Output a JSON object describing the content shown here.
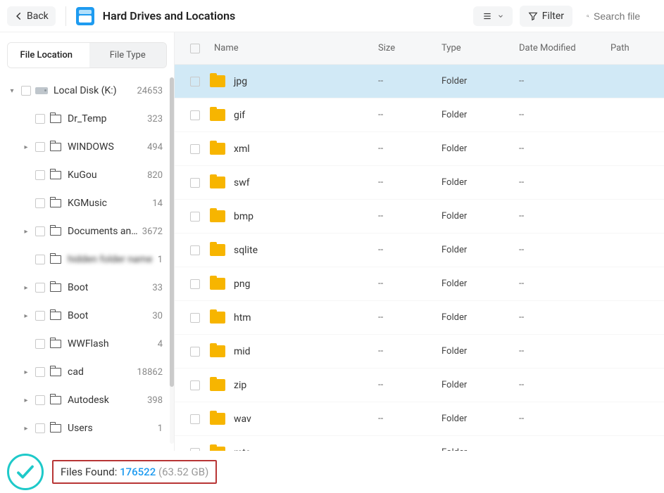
{
  "header": {
    "back_label": "Back",
    "title": "Hard Drives and Locations",
    "filter_label": "Filter",
    "search_placeholder": "Search file"
  },
  "sidebar": {
    "tabs": {
      "location": "File Location",
      "type": "File Type"
    },
    "items": [
      {
        "label": "Local Disk (K:)",
        "count": "24653",
        "depth": 0,
        "caret": "▾",
        "icon": "disk",
        "blurred": false
      },
      {
        "label": "Dr_Temp",
        "count": "323",
        "depth": 1,
        "caret": "",
        "icon": "folder",
        "blurred": false
      },
      {
        "label": "WINDOWS",
        "count": "494",
        "depth": 1,
        "caret": "▸",
        "icon": "folder",
        "blurred": false
      },
      {
        "label": "KuGou",
        "count": "820",
        "depth": 1,
        "caret": "",
        "icon": "folder",
        "blurred": false
      },
      {
        "label": "KGMusic",
        "count": "14",
        "depth": 1,
        "caret": "",
        "icon": "folder",
        "blurred": false
      },
      {
        "label": "Documents and Set...",
        "count": "3672",
        "depth": 1,
        "caret": "▸",
        "icon": "folder",
        "blurred": false
      },
      {
        "label": "hidden folder name",
        "count": "1",
        "depth": 1,
        "caret": "",
        "icon": "folder",
        "blurred": true
      },
      {
        "label": "Boot",
        "count": "33",
        "depth": 1,
        "caret": "▸",
        "icon": "folder",
        "blurred": false
      },
      {
        "label": "Boot",
        "count": "30",
        "depth": 1,
        "caret": "▸",
        "icon": "folder",
        "blurred": false
      },
      {
        "label": "WWFlash",
        "count": "4",
        "depth": 1,
        "caret": "",
        "icon": "folder",
        "blurred": false
      },
      {
        "label": "cad",
        "count": "18862",
        "depth": 1,
        "caret": "▸",
        "icon": "folder",
        "blurred": false
      },
      {
        "label": "Autodesk",
        "count": "398",
        "depth": 1,
        "caret": "▸",
        "icon": "folder",
        "blurred": false
      },
      {
        "label": "Users",
        "count": "1",
        "depth": 1,
        "caret": "▸",
        "icon": "folder",
        "blurred": false
      }
    ]
  },
  "columns": {
    "name": "Name",
    "size": "Size",
    "type": "Type",
    "date": "Date Modified",
    "path": "Path"
  },
  "rows": [
    {
      "name": "jpg",
      "size": "--",
      "type": "Folder",
      "date": "--",
      "selected": true
    },
    {
      "name": "gif",
      "size": "--",
      "type": "Folder",
      "date": "--",
      "selected": false
    },
    {
      "name": "xml",
      "size": "--",
      "type": "Folder",
      "date": "--",
      "selected": false
    },
    {
      "name": "swf",
      "size": "--",
      "type": "Folder",
      "date": "--",
      "selected": false
    },
    {
      "name": "bmp",
      "size": "--",
      "type": "Folder",
      "date": "--",
      "selected": false
    },
    {
      "name": "sqlite",
      "size": "--",
      "type": "Folder",
      "date": "--",
      "selected": false
    },
    {
      "name": "png",
      "size": "--",
      "type": "Folder",
      "date": "--",
      "selected": false
    },
    {
      "name": "htm",
      "size": "--",
      "type": "Folder",
      "date": "--",
      "selected": false
    },
    {
      "name": "mid",
      "size": "--",
      "type": "Folder",
      "date": "--",
      "selected": false
    },
    {
      "name": "zip",
      "size": "--",
      "type": "Folder",
      "date": "--",
      "selected": false
    },
    {
      "name": "wav",
      "size": "--",
      "type": "Folder",
      "date": "--",
      "selected": false
    },
    {
      "name": "mts",
      "size": "--",
      "type": "Folder",
      "date": "--",
      "selected": false
    }
  ],
  "footer": {
    "label": "Files Found:",
    "count": "176522",
    "size": "(63.52 GB)"
  }
}
